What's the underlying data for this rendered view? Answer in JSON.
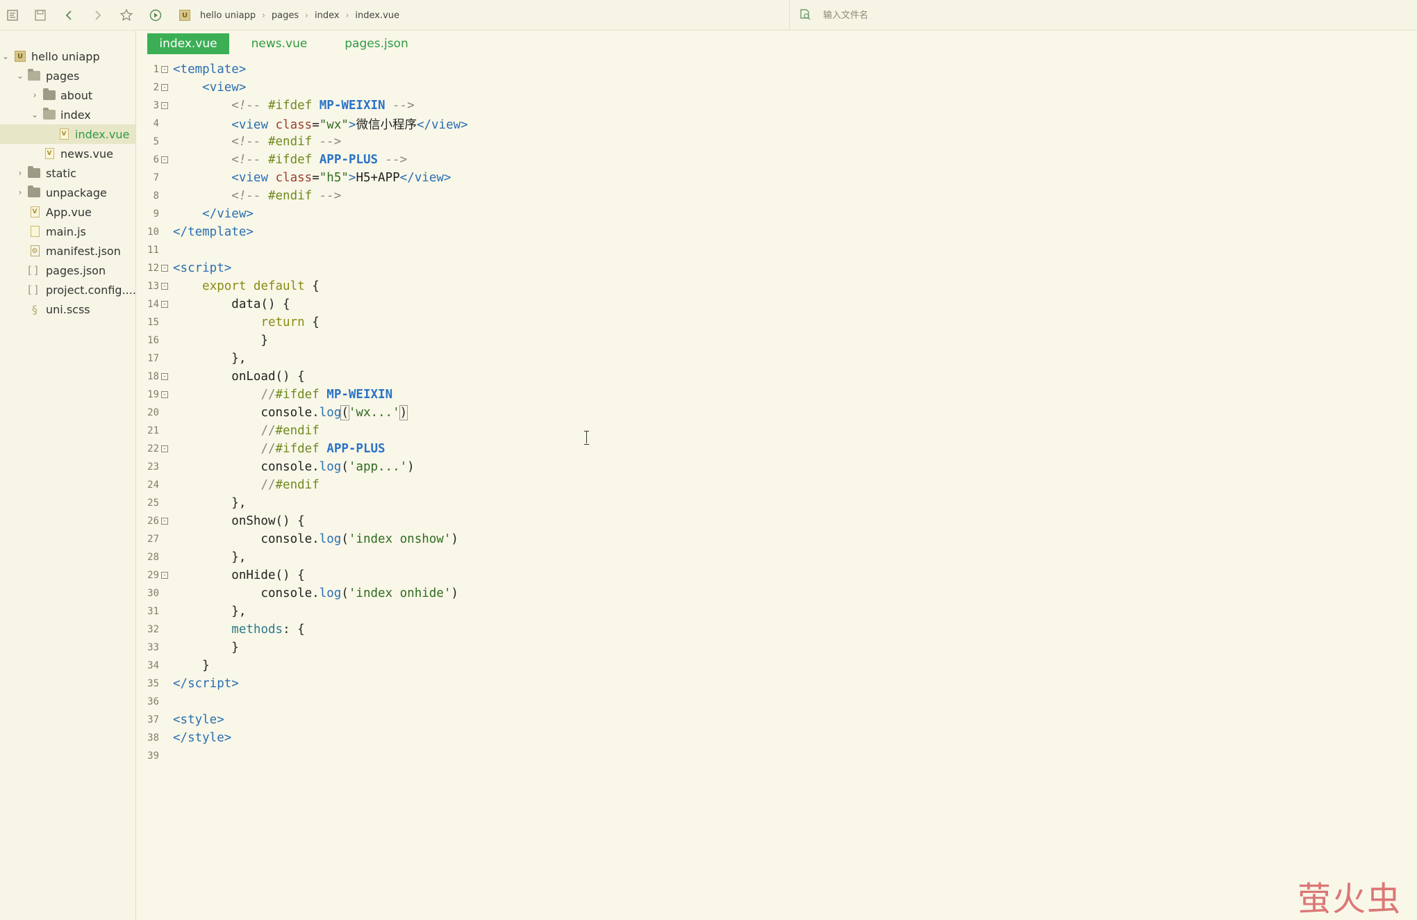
{
  "toolbar": {
    "icons": [
      "file-tree-icon",
      "save-icon",
      "back-icon",
      "forward-icon",
      "star-icon",
      "run-icon"
    ],
    "breadcrumb": [
      "hello uniapp",
      "pages",
      "index",
      "index.vue"
    ],
    "file_search": {
      "placeholder": "输入文件名"
    }
  },
  "sidebar": {
    "project": "hello uniapp",
    "items": [
      {
        "label": "pages",
        "type": "folder"
      },
      {
        "label": "about",
        "type": "folder"
      },
      {
        "label": "index",
        "type": "folder"
      },
      {
        "label": "index.vue",
        "type": "vue"
      },
      {
        "label": "news.vue",
        "type": "vue"
      },
      {
        "label": "static",
        "type": "folder"
      },
      {
        "label": "unpackage",
        "type": "folder"
      },
      {
        "label": "App.vue",
        "type": "vue"
      },
      {
        "label": "main.js",
        "type": "js"
      },
      {
        "label": "manifest.json",
        "type": "json"
      },
      {
        "label": "pages.json",
        "type": "json"
      },
      {
        "label": "project.config....",
        "type": "json"
      },
      {
        "label": "uni.scss",
        "type": "scss"
      }
    ]
  },
  "tabs": [
    {
      "label": "index.vue",
      "active": true
    },
    {
      "label": "news.vue",
      "active": false
    },
    {
      "label": "pages.json",
      "active": false
    }
  ],
  "editor": {
    "lines": [
      "1",
      "2",
      "3",
      "4",
      "5",
      "6",
      "7",
      "8",
      "9",
      "10",
      "11",
      "12",
      "13",
      "14",
      "15",
      "16",
      "17",
      "18",
      "19",
      "20",
      "21",
      "22",
      "23",
      "24",
      "25",
      "26",
      "27",
      "28",
      "29",
      "30",
      "31",
      "32",
      "33",
      "34",
      "35",
      "36",
      "37",
      "38",
      "39"
    ]
  },
  "watermark": "萤火虫",
  "colors": {
    "accent": "#3cae55",
    "background": "#f9f7e8",
    "tag": "#2a6fb2",
    "string": "#2f6b20",
    "comment": "#8a8a78"
  }
}
